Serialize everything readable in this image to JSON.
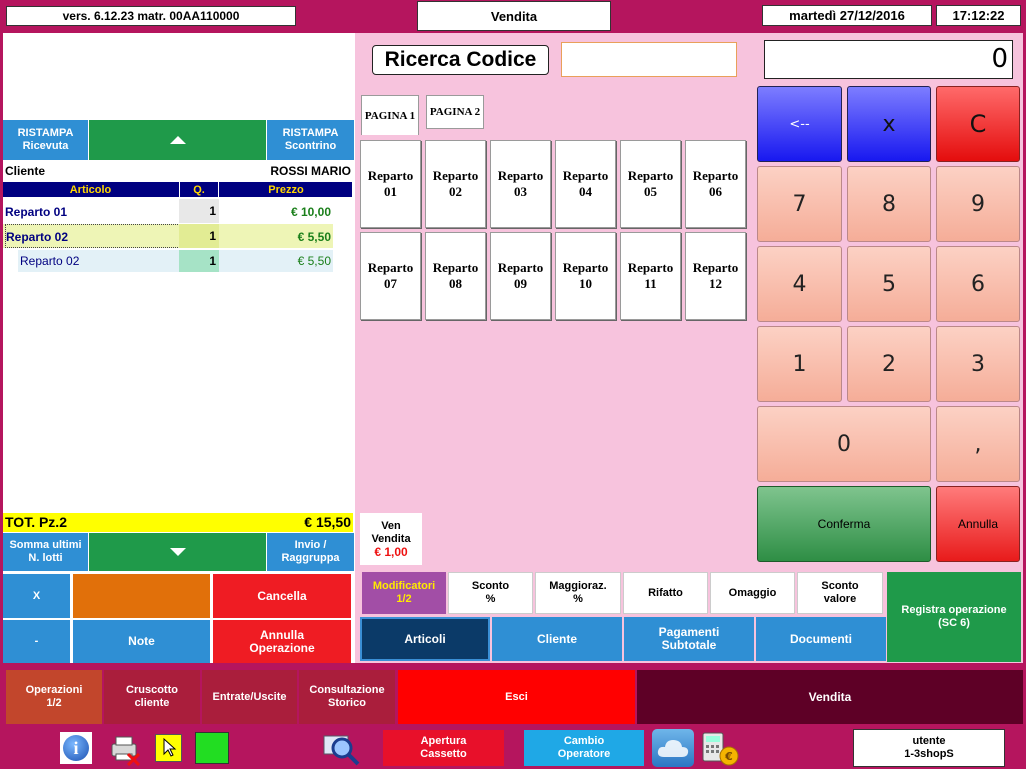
{
  "header": {
    "version": "vers. 6.12.23 matr. 00AA110000",
    "mode": "Vendita",
    "date": "martedì 27/12/2016",
    "time": "17:12:22"
  },
  "cart": {
    "reprint_receipt": [
      "RISTAMPA",
      "Ricevuta"
    ],
    "reprint_ticket": [
      "RISTAMPA",
      "Scontrino"
    ],
    "client_label": "Cliente",
    "client_name": "ROSSI MARIO",
    "columns": [
      "Articolo",
      "Q.",
      "Prezzo"
    ],
    "rows": [
      {
        "article": "Reparto 01",
        "qty": "1",
        "price": "€ 10,00"
      },
      {
        "article": "Reparto 02",
        "qty": "1",
        "price": "€ 5,50"
      },
      {
        "article": "Reparto 02",
        "qty": "1",
        "price": "€ 5,50"
      }
    ],
    "total_label": "TOT. Pz.2",
    "total_value": "€ 15,50",
    "sum_lots": [
      "Somma ultimi",
      "N. lotti"
    ],
    "send_group": [
      "Invio /",
      "Raggruppa"
    ]
  },
  "cart_actions": {
    "x": "X",
    "cancel": "Cancella",
    "minus": "-",
    "notes": "Note",
    "cancel_op": [
      "Annulla",
      "Operazione"
    ]
  },
  "search": {
    "label": "Ricerca Codice",
    "value": ""
  },
  "display": {
    "value": "0"
  },
  "pages": [
    "PAGINA 1",
    "PAGINA 2"
  ],
  "departments": [
    [
      "Reparto",
      "01"
    ],
    [
      "Reparto",
      "02"
    ],
    [
      "Reparto",
      "03"
    ],
    [
      "Reparto",
      "04"
    ],
    [
      "Reparto",
      "05"
    ],
    [
      "Reparto",
      "06"
    ],
    [
      "Reparto",
      "07"
    ],
    [
      "Reparto",
      "08"
    ],
    [
      "Reparto",
      "09"
    ],
    [
      "Reparto",
      "10"
    ],
    [
      "Reparto",
      "11"
    ],
    [
      "Reparto",
      "12"
    ]
  ],
  "keypad": {
    "back": "<--",
    "mult": "x",
    "clear": "C",
    "digits": [
      "7",
      "8",
      "9",
      "4",
      "5",
      "6",
      "1",
      "2",
      "3"
    ],
    "zero": "0",
    "comma": ",",
    "confirm": "Conferma",
    "cancel": "Annulla"
  },
  "sale_card": {
    "lines": [
      "Ven",
      "Vendita"
    ],
    "price": "€ 1,00"
  },
  "modifiers": [
    [
      "Modificatori",
      "1/2"
    ],
    [
      "Sconto",
      "%"
    ],
    [
      "Maggioraz.",
      "%"
    ],
    [
      "Rifatto"
    ],
    [
      "Omaggio"
    ],
    [
      "Sconto",
      "valore"
    ]
  ],
  "register_op": [
    "Registra operazione",
    "(SC 6)"
  ],
  "nav": {
    "articoli": "Articoli",
    "cliente": "Cliente",
    "pagamenti": [
      "Pagamenti",
      "Subtotale"
    ],
    "documenti": "Documenti"
  },
  "bottom_bar": {
    "operations": [
      "Operazioni",
      "1/2"
    ],
    "dashboard": [
      "Cruscotto",
      "cliente"
    ],
    "in_out": "Entrate/Uscite",
    "history": [
      "Consultazione",
      "Storico"
    ],
    "exit": "Esci",
    "sale": "Vendita"
  },
  "taskbar": {
    "drawer": [
      "Apertura",
      "Cassetto"
    ],
    "change_op": [
      "Cambio",
      "Operatore"
    ],
    "user": [
      "utente",
      "1-3shopS"
    ]
  },
  "colors": {
    "frame": "#b5155e",
    "pink_panel": "#f7c3dd",
    "blue": "#2f8fd4",
    "green": "#1f9a4a",
    "red": "#ef1c23",
    "orange": "#e1700a",
    "yellow_total": "#ffff00",
    "navy_header": "#000080",
    "purple_modifier": "#a24ea6",
    "brown": "#c2462c",
    "dark_red": "#aa1e3c",
    "maroon": "#5e0026"
  }
}
